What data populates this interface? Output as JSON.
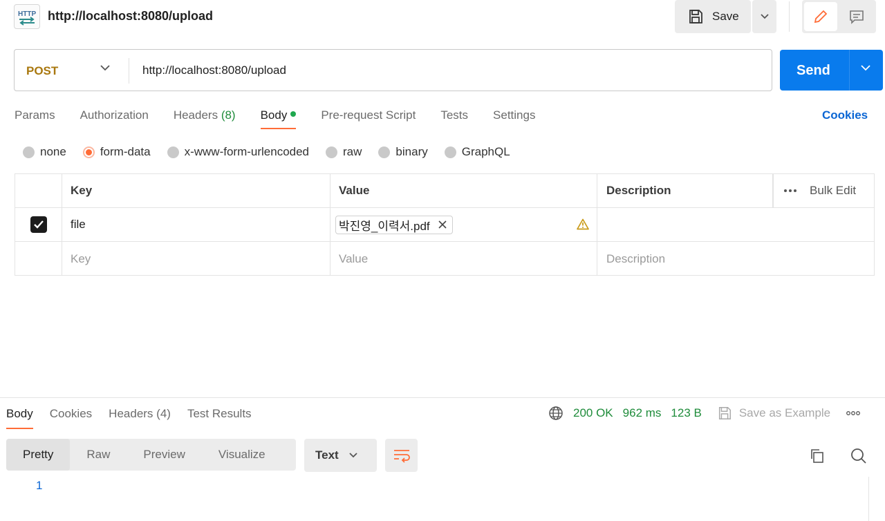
{
  "tab": {
    "icon": "http-icon",
    "icon_text": "HTTP",
    "title": "http://localhost:8080/upload"
  },
  "toolbar": {
    "save_label": "Save",
    "save_icon": "floppy-disk-icon",
    "edit_icon": "pencil-icon",
    "comment_icon": "comment-icon"
  },
  "request": {
    "method": "POST",
    "url": "http://localhost:8080/upload",
    "send_label": "Send"
  },
  "request_tabs": [
    {
      "label": "Params"
    },
    {
      "label": "Authorization"
    },
    {
      "label": "Headers",
      "count": "(8)"
    },
    {
      "label": "Body",
      "active": true
    },
    {
      "label": "Pre-request Script"
    },
    {
      "label": "Tests"
    },
    {
      "label": "Settings"
    }
  ],
  "cookies_link": "Cookies",
  "body_types": [
    {
      "label": "none"
    },
    {
      "label": "form-data",
      "selected": true
    },
    {
      "label": "x-www-form-urlencoded"
    },
    {
      "label": "raw"
    },
    {
      "label": "binary"
    },
    {
      "label": "GraphQL"
    }
  ],
  "params_table": {
    "headers": {
      "key": "Key",
      "value": "Value",
      "description": "Description",
      "bulk_edit": "Bulk Edit"
    },
    "rows": [
      {
        "checked": true,
        "key": "file",
        "value_file": "박진영_이력서.pdf",
        "description": "",
        "warning_icon": "warning-icon"
      }
    ],
    "placeholders": {
      "key": "Key",
      "value": "Value",
      "description": "Description"
    }
  },
  "response": {
    "tabs": [
      {
        "label": "Body",
        "active": true
      },
      {
        "label": "Cookies"
      },
      {
        "label": "Headers",
        "count": "(4)"
      },
      {
        "label": "Test Results"
      }
    ],
    "status": "200 OK",
    "time": "962 ms",
    "size": "123 B",
    "save_example": "Save as Example",
    "view_modes": [
      "Pretty",
      "Raw",
      "Preview",
      "Visualize"
    ],
    "active_view": "Pretty",
    "format": "Text",
    "line_numbers": [
      "1"
    ]
  },
  "colors": {
    "accent": "#ff6c37",
    "send": "#097bed",
    "method": "#a9780f",
    "status_green": "#1f8c3b",
    "link": "#0b66d4"
  }
}
